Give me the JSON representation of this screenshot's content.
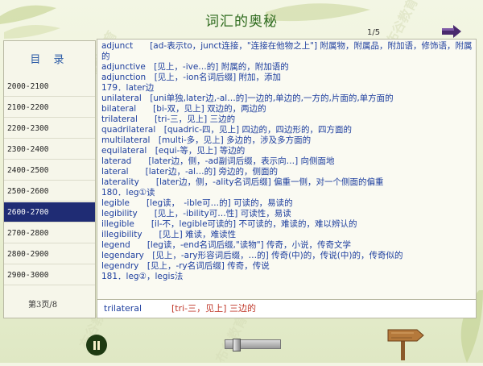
{
  "header": {
    "title": "词汇的奥秘",
    "page_indicator": "1/5"
  },
  "watermark": "布谷教育",
  "sidebar": {
    "title": "目 录",
    "items": [
      {
        "label": "2000-2100",
        "active": false
      },
      {
        "label": "2100-2200",
        "active": false
      },
      {
        "label": "2200-2300",
        "active": false
      },
      {
        "label": "2300-2400",
        "active": false
      },
      {
        "label": "2400-2500",
        "active": false
      },
      {
        "label": "2500-2600",
        "active": false
      },
      {
        "label": "2600-2700",
        "active": true
      },
      {
        "label": "2700-2800",
        "active": false
      },
      {
        "label": "2800-2900",
        "active": false
      },
      {
        "label": "2900-3000",
        "active": false
      }
    ],
    "page_count": "第3页/8"
  },
  "entries": [
    "adjunct　　[ad-表示to，junct连接，\"连接在他物之上\"] 附属物，附属品，附加语，修饰语，附属的",
    "adjunctive　[见上，-ive…的] 附属的，附加语的",
    "adjunction　[见上，-ion名词后缀] 附加，添加",
    "179．later边",
    "unilateral　[uni单独,later边,-al…的]一边的,单边的,一方的,片面的,单方面的",
    "bilateral　　[bi-双，见上] 双边的，两边的",
    "trilateral　　[tri-三，见上] 三边的",
    "quadrilateral　[quadric-四，见上] 四边的，四边形的，四方面的",
    "multilateral　[multi-多，见上] 多边的，涉及多方面的",
    "equilateral　[equi-等，见上] 等边的",
    "laterad　　[later边，侧，-ad副词后缀，表示向…] 向侧面地",
    "lateral　　[later边，-al…的] 旁边的，侧面的",
    "laterality　　[later边，侧，-ality名词后缀] 偏重一侧，对一个侧面的偏重",
    "180．leg①读",
    "legible　　[leg读，　-ible可…的] 可读的，易读的",
    "legibility　　[见上，-ibility可…性] 可读性，易读",
    "illegible　　[il-不，legible可读的] 不可读的，难读的，难以辨认的",
    "illegibility　　[见上] 难读，难读性",
    "legend　　[leg读，-end名词后缀,\"读物\"] 传奇，小说，传奇文学",
    "legendary　[见上，-ary形容词后缀，…的] 传奇(中)的，传说(中)的，传奇似的",
    "legendry　[见上，-ry名词后缀] 传奇，传说",
    "181．leg②，legis法"
  ],
  "bottom_bar": {
    "word": "trilateral",
    "definition": "[tri-三，见上] 三边的"
  },
  "controls": {
    "slider_level": 0.15
  },
  "icons": {
    "next": "right-arrow-icon",
    "pause": "pause-icon",
    "sign": "signpost-icon"
  },
  "colors": {
    "title": "#2e6b1e",
    "entry_text": "#1d3e9e",
    "definition": "#c0392b",
    "active_item_bg": "#1f2c74"
  }
}
